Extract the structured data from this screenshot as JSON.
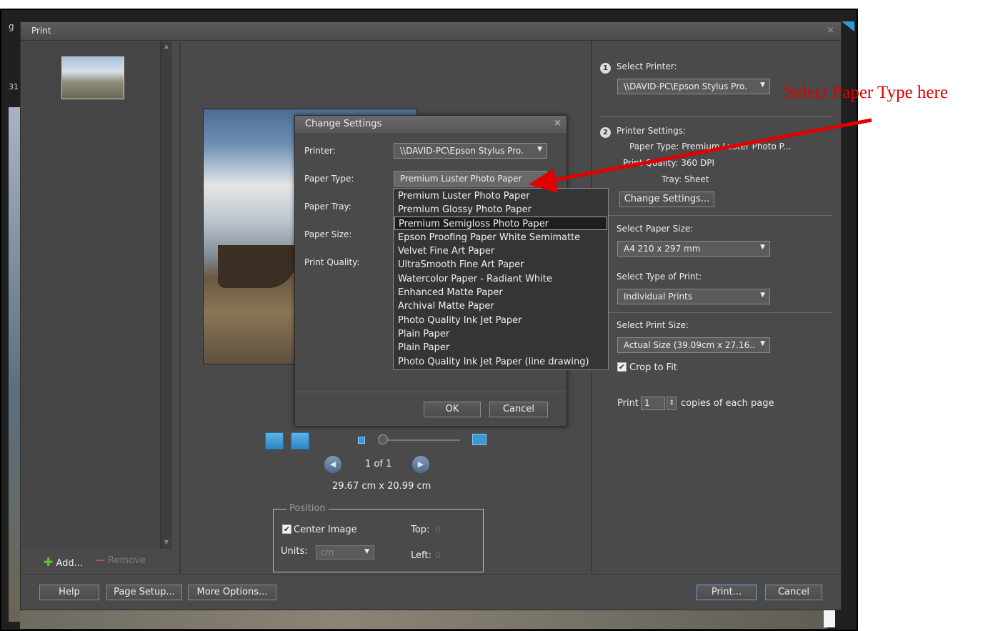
{
  "background": {
    "fragment_1": "g",
    "fragment_2": "31"
  },
  "print_dialog": {
    "title": "Print",
    "close_glyph": "×",
    "thumbnails": {
      "add_label": "Add...",
      "remove_label": "Remove"
    },
    "preview": {
      "page_indicator": "1 of 1",
      "print_dimension": "29.67 cm x 20.99 cm"
    },
    "position": {
      "legend": "Position",
      "center_image_label": "Center Image",
      "center_image_checked": true,
      "units_label": "Units:",
      "units_value": "cm",
      "top_label": "Top:",
      "top_value": "0",
      "left_label": "Left:",
      "left_value": "0"
    },
    "settings": {
      "step1_number": "1",
      "select_printer_label": "Select Printer:",
      "printer_value": "\\\\DAVID-PC\\Epson Stylus Pro. ",
      "step2_number": "2",
      "printer_settings_label": "Printer Settings:",
      "paper_type_summary": "Paper Type: Premium Luster Photo P...",
      "print_quality_summary": "Print Quality: 360 DPI",
      "tray_summary": "Tray: Sheet",
      "change_settings_button": "Change Settings...",
      "select_paper_size_label": "Select Paper Size:",
      "paper_size_value": "A4 210 x 297 mm",
      "select_type_of_print_label": "Select Type of Print:",
      "type_of_print_value": "Individual Prints",
      "select_print_size_label": "Select Print Size:",
      "print_size_value": "Actual Size (39.09cm x 27.16..",
      "crop_to_fit_label": "Crop to Fit",
      "crop_to_fit_checked": true,
      "copies_prefix": "Print",
      "copies_value": "1",
      "copies_suffix": "copies of each page"
    },
    "buttons": {
      "help": "Help",
      "page_setup": "Page Setup...",
      "more_options": "More Options...",
      "print": "Print...",
      "cancel": "Cancel"
    }
  },
  "change_settings_dialog": {
    "title": "Change Settings",
    "close_glyph": "×",
    "printer_label": "Printer:",
    "printer_value": "\\\\DAVID-PC\\Epson Stylus Pro. ",
    "paper_type_label": "Paper Type:",
    "paper_type_value": "Premium Luster Photo Paper",
    "paper_tray_label": "Paper Tray:",
    "paper_size_label": "Paper Size:",
    "print_quality_label": "Print Quality:",
    "ok_button": "OK",
    "cancel_button": "Cancel",
    "paper_type_options": [
      "Premium Luster Photo Paper",
      "Premium Glossy Photo Paper",
      "Premium Semigloss Photo Paper",
      "Epson Proofing Paper White Semimatte",
      "Velvet Fine Art Paper",
      "UltraSmooth Fine Art Paper",
      "Watercolor Paper - Radiant White",
      "Enhanced Matte Paper",
      "Archival Matte Paper",
      "Photo Quality Ink Jet Paper",
      "Plain Paper",
      "Plain Paper",
      "Photo Quality Ink Jet Paper (line drawing)"
    ],
    "highlighted_option": "Premium Semigloss Photo Paper"
  },
  "annotation": {
    "text": "Select Paper Type here",
    "color": "#e00000"
  },
  "colors": {
    "dialog_bg": "#4a4a4a",
    "accent_blue": "#2c86c4"
  }
}
